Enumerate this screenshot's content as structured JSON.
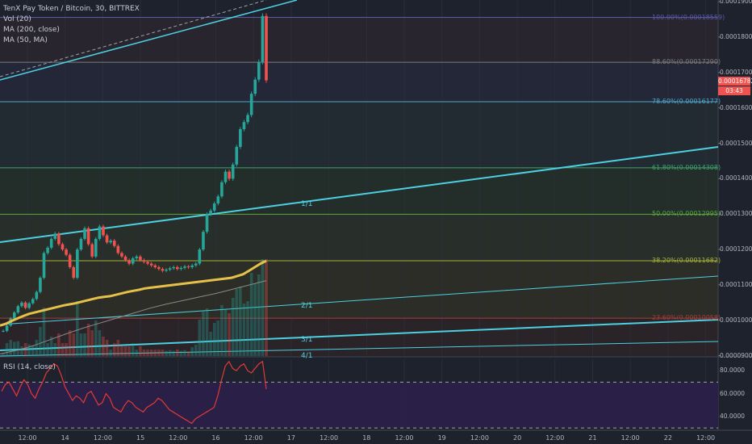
{
  "legend": {
    "title": "TenX Pay Token / Bitcoin, 30, BITTREX",
    "vol": "Vol (20)",
    "ma200": "MA (200, close)",
    "ma50": "MA (50, MA)"
  },
  "rsi_title": "RSI (14, close)",
  "price_tag": "0.00016782",
  "countdown_tag": "03:43",
  "colors": {
    "background": "#1e222d",
    "fib_100": "#5a5aa8",
    "fib_886": "#7c7c7c",
    "fib_786": "#4fa6c8",
    "fib_618": "#3fa36a",
    "fib_500": "#5aa83c",
    "fib_382": "#a8b03c",
    "fib_236": "#a83c3c",
    "gann": "#4dd0e1",
    "ma50": "#e6c14a",
    "ma200": "#8a8a8a",
    "up": "#26a69a",
    "down": "#ef5350",
    "rsi": "#e53935",
    "rsi_band": "#2a1f4a"
  },
  "chart_data": {
    "type": "line",
    "y_axis_labels": [
      "0.00019000",
      "0.00018000",
      "0.00017000",
      "0.00016000",
      "0.00015000",
      "0.00014000",
      "0.00013000",
      "0.00012000",
      "0.00011000",
      "0.00010000",
      "0.00009000"
    ],
    "ylim": [
      8.99e-05,
      0.0001905
    ],
    "x_axis_labels": [
      "12:00",
      "14",
      "12:00",
      "15",
      "12:00",
      "16",
      "12:00",
      "17",
      "12:00",
      "18",
      "12:00",
      "19",
      "12:00",
      "20",
      "12:00",
      "21",
      "12:00",
      "22",
      "12:00"
    ],
    "fib_levels": [
      {
        "label": "100.00%(0.00018559)",
        "value": 0.00018559,
        "key": "fib_100"
      },
      {
        "label": "88.60%(0.00017290)",
        "value": 0.0001729,
        "key": "fib_886"
      },
      {
        "label": "78.60%(0.00016177)",
        "value": 0.00016177,
        "key": "fib_786"
      },
      {
        "label": "61.80%(0.00014308)",
        "value": 0.00014308,
        "key": "fib_618"
      },
      {
        "label": "50.00%(0.00012995)",
        "value": 0.00012995,
        "key": "fib_500"
      },
      {
        "label": "38.20%(0.00011682)",
        "value": 0.00011682,
        "key": "fib_382"
      },
      {
        "label": "23.60%(0.00010058)",
        "value": 0.00010058,
        "key": "fib_236"
      }
    ],
    "gann_labels": [
      "1/1",
      "2/1",
      "3/1",
      "4/1"
    ],
    "last_price": 0.00016782,
    "rsi_axis_labels": [
      "80.0000",
      "60.0000",
      "40.0000"
    ],
    "rsi_levels": [
      70,
      30
    ],
    "rsi_ylim": [
      28,
      90
    ],
    "price_series": [
      9.7e-05,
      9.85e-05,
      0.0001005,
      0.0001022,
      0.000104,
      0.000105,
      0.0001035,
      0.0001048,
      0.000106,
      0.000108,
      0.000112,
      0.000119,
      0.0001205,
      0.000123,
      0.0001245,
      0.0001215,
      0.00012,
      0.0001185,
      0.000115,
      0.000112,
      0.00012,
      0.000123,
      0.000126,
      0.0001215,
      0.000118,
      0.000123,
      0.0001265,
      0.000124,
      0.000122,
      0.0001225,
      0.000121,
      0.000119,
      0.000118,
      0.000117,
      0.000116,
      0.0001175,
      0.000118,
      0.000117,
      0.0001165,
      0.000116,
      0.0001155,
      0.000115,
      0.0001145,
      0.000114,
      0.0001143,
      0.0001147,
      0.000115,
      0.0001145,
      0.0001148,
      0.0001152,
      0.000115,
      0.0001155,
      0.000116,
      0.00012,
      0.000125,
      0.00013,
      0.000131,
      0.000133,
      0.000135,
      0.000139,
      0.000142,
      0.00014,
      0.000144,
      0.000149,
      0.000154,
      0.000156,
      0.000158,
      0.000164,
      0.000168,
      0.000173,
      0.000186,
      0.0001678
    ],
    "ma50_series": [
      9.85e-05,
      9.9e-05,
      9.98e-05,
      0.0001005,
      0.0001012,
      0.0001018,
      0.0001022,
      0.0001026,
      0.000103,
      0.0001034,
      0.0001038,
      0.0001042,
      0.0001045,
      0.0001048,
      0.0001052,
      0.0001056,
      0.000106,
      0.0001064,
      0.0001066,
      0.0001068,
      0.0001072,
      0.0001076,
      0.000108,
      0.0001083,
      0.0001086,
      0.000109,
      0.0001092,
      0.0001094,
      0.0001096,
      0.0001098,
      0.00011,
      0.0001102,
      0.0001104,
      0.0001106,
      0.0001108,
      0.000111,
      0.0001112,
      0.0001114,
      0.0001116,
      0.0001118,
      0.000112,
      0.0001125,
      0.000113,
      0.000114,
      0.000115,
      0.000116,
      0.0001168
    ],
    "ma200_series": [
      9.05e-05,
      9.15e-05,
      9.28e-05,
      9.45e-05,
      9.62e-05,
      9.78e-05,
      9.92e-05,
      0.0001006,
      0.000102,
      0.0001034,
      0.0001046,
      0.0001056,
      0.0001066,
      0.0001076,
      0.0001088,
      0.00011,
      0.0001112
    ],
    "rsi_series": [
      62,
      68,
      70,
      64,
      58,
      66,
      72,
      68,
      60,
      56,
      64,
      70,
      78,
      82,
      86,
      84,
      76,
      66,
      60,
      54,
      58,
      56,
      52,
      60,
      62,
      56,
      50,
      52,
      60,
      56,
      48,
      46,
      44,
      50,
      54,
      52,
      48,
      46,
      44,
      48,
      50,
      52,
      56,
      54,
      50,
      46,
      44,
      42,
      40,
      38,
      36,
      34,
      38,
      40,
      42,
      44,
      46,
      48,
      58,
      72,
      84,
      88,
      82,
      80,
      84,
      86,
      80,
      78,
      82,
      86,
      88,
      64
    ]
  }
}
